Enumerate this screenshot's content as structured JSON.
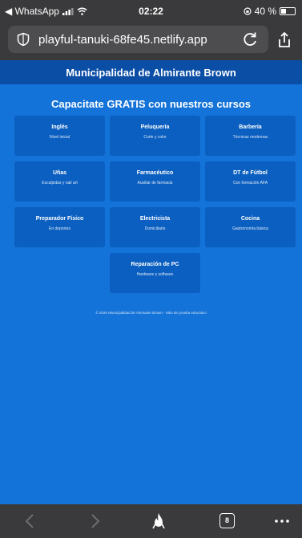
{
  "status_bar": {
    "back_app": "◀ WhatsApp",
    "time": "02:22",
    "battery": "40 %",
    "battery_level": 0.4
  },
  "browser": {
    "url": "playful-tanuki-68fe45.netlify.app",
    "tabs_count": "8"
  },
  "header": {
    "title": "Municipalidad de Almirante Brown"
  },
  "main": {
    "headline": "Capacitate GRATIS con nuestros cursos",
    "courses": [
      {
        "title": "Inglés",
        "subtitle": "Nivel inicial"
      },
      {
        "title": "Peluquería",
        "subtitle": "Corte y color"
      },
      {
        "title": "Barbería",
        "subtitle": "Técnicas modernas"
      },
      {
        "title": "Uñas",
        "subtitle": "Esculpidas y nail art"
      },
      {
        "title": "Farmacéutico",
        "subtitle": "Auxiliar de farmacia"
      },
      {
        "title": "DT de Fútbol",
        "subtitle": "Con formación AFA"
      },
      {
        "title": "Preparador Físico",
        "subtitle": "En deportes"
      },
      {
        "title": "Electricista",
        "subtitle": "Domiciliario"
      },
      {
        "title": "Cocina",
        "subtitle": "Gastronomía básica"
      },
      {
        "title": "Reparación de PC",
        "subtitle": "Hardware y software"
      }
    ],
    "footer_note": "© 2025 Municipalidad de Almirante Brown - Sitio de prueba educativo"
  },
  "colors": {
    "page_bg": "#1473d8",
    "header_bg": "#0b4ea6",
    "card_bg": "#0b5fc0",
    "chrome_bg": "#3a3a3c"
  },
  "icons": {
    "shield": "shield-icon",
    "reload": "reload-icon",
    "share": "share-icon",
    "back": "back-arrow-icon",
    "forward": "forward-arrow-icon",
    "flame": "flame-icon",
    "more": "more-icon"
  }
}
